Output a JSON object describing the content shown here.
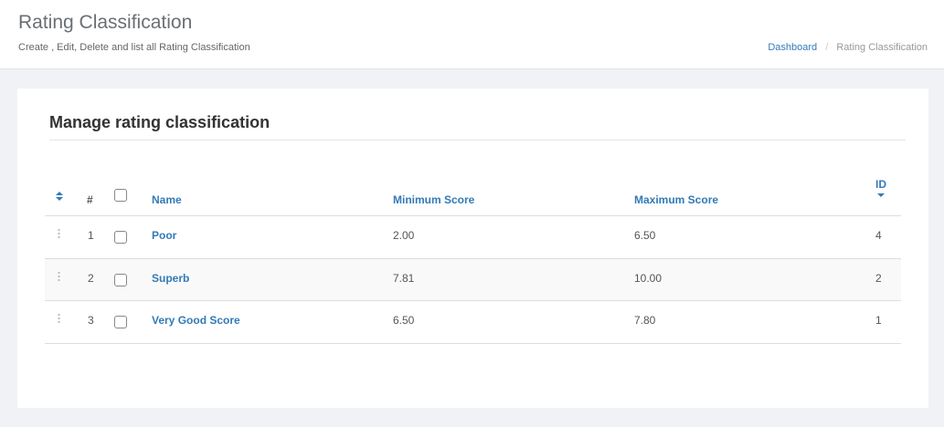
{
  "header": {
    "title": "Rating Classification",
    "subtitle": "Create , Edit, Delete and list all Rating Classification",
    "breadcrumb": {
      "home": "Dashboard",
      "separator": "/",
      "current": "Rating Classification"
    }
  },
  "card": {
    "title": "Manage rating classification"
  },
  "table": {
    "columns": {
      "hash": "#",
      "name": "Name",
      "min_score": "Minimum Score",
      "max_score": "Maximum Score",
      "id": "ID"
    },
    "rows": [
      {
        "num": "1",
        "name": "Poor",
        "min": "2.00",
        "max": "6.50",
        "id": "4"
      },
      {
        "num": "2",
        "name": "Superb",
        "min": "7.81",
        "max": "10.00",
        "id": "2"
      },
      {
        "num": "3",
        "name": "Very Good Score",
        "min": "6.50",
        "max": "7.80",
        "id": "1"
      }
    ]
  },
  "icons": {
    "sort_all": "sort-both-icon",
    "sort_id": "sort-down-icon",
    "drag": "drag-handle-icon"
  },
  "colors": {
    "link": "#337ab7",
    "background": "#f1f2f5",
    "row_stripe": "#f9f9f9"
  }
}
